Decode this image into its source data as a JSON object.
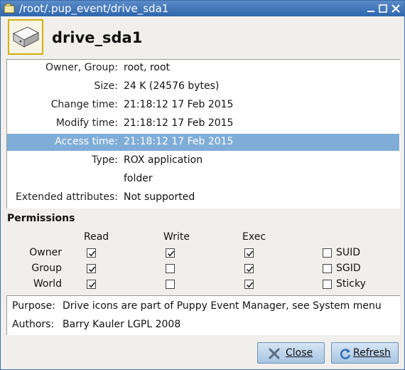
{
  "window": {
    "title": "/root/.pup_event/drive_sda1"
  },
  "header": {
    "file_name": "drive_sda1",
    "icon": "drive-icon"
  },
  "info": {
    "rows": [
      {
        "label": "Owner, Group:",
        "value": "root, root"
      },
      {
        "label": "Size:",
        "value": "24 K (24576 bytes)"
      },
      {
        "label": "Change time:",
        "value": "21:18:12 17 Feb 2015"
      },
      {
        "label": "Modify time:",
        "value": "21:18:12 17 Feb 2015"
      },
      {
        "label": "Access time:",
        "value": "21:18:12 17 Feb 2015",
        "selected": true
      },
      {
        "label": "Type:",
        "value": "ROX application"
      },
      {
        "label": "",
        "value": "folder"
      },
      {
        "label": "Extended attributes:",
        "value": "Not supported"
      }
    ]
  },
  "permissions": {
    "title": "Permissions",
    "columns": [
      "Read",
      "Write",
      "Exec"
    ],
    "rows": [
      {
        "label": "Owner",
        "read": true,
        "write": true,
        "exec": true,
        "extra_label": "SUID",
        "extra": false
      },
      {
        "label": "Group",
        "read": true,
        "write": false,
        "exec": true,
        "extra_label": "SGID",
        "extra": false
      },
      {
        "label": "World",
        "read": true,
        "write": false,
        "exec": true,
        "extra_label": "Sticky",
        "extra": false
      }
    ]
  },
  "description": {
    "purpose_key": "Purpose:",
    "purpose_value": "Drive icons are part of Puppy Event Manager, see System menu",
    "authors_key": "Authors:",
    "authors_value": "Barry Kauler LGPL 2008"
  },
  "buttons": {
    "close_label": "Close",
    "refresh_label": "Refresh"
  },
  "colors": {
    "titlebar": "#2f66ad",
    "selected_row": "#7fadd8",
    "icon_border": "#d4b007"
  }
}
